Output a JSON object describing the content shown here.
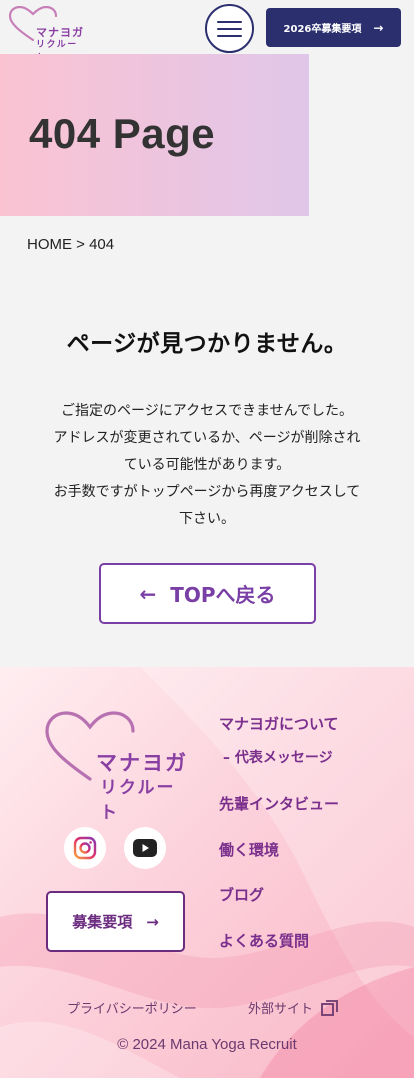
{
  "header": {
    "logo_line1": "マナヨガ",
    "logo_line2": "リクルート",
    "recruit_label": "2026卒募集要項",
    "recruit_arrow": "→"
  },
  "hero": {
    "title": "404 Page"
  },
  "breadcrumb": "HOME > 404",
  "main": {
    "title": "ページが見つかりません。",
    "message_lines": [
      "ご指定のページにアクセスできませんでした。",
      "アドレスが変更されているか、ページが削除され",
      "ている可能性があります。",
      "お手数ですがトップページから再度アクセスして",
      "下さい。"
    ],
    "top_button_arrow": "←",
    "top_button_label": "TOPへ戻る"
  },
  "footer": {
    "logo_line1": "マナヨガ",
    "logo_line2": "リクルート",
    "recruit_label": "募集要項",
    "recruit_arrow": "→",
    "nav": [
      "マナヨガについて",
      "– 代表メッセージ",
      "先輩インタビュー",
      "働く環境",
      "ブログ",
      "よくある質問"
    ],
    "privacy": "プライバシーポリシー",
    "external": "外部サイト",
    "copyright": "© 2024 Mana Yoga Recruit"
  },
  "colors": {
    "navy": "#2b2f6e",
    "purple": "#7a3fa5",
    "hero_gradient_start": "#fbc3d2",
    "hero_gradient_end": "#e0c6e9"
  },
  "icons": [
    "heart-logo-icon",
    "menu-icon",
    "instagram-icon",
    "youtube-icon",
    "external-link-icon"
  ]
}
